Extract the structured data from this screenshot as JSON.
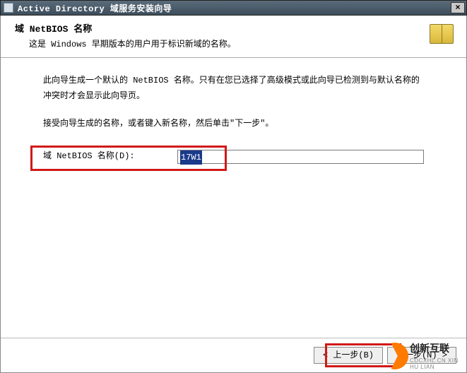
{
  "titlebar": {
    "title": "Active Directory 域服务安装向导",
    "close_label": "×"
  },
  "header": {
    "title": "域 NetBIOS 名称",
    "subtitle": "这是 Windows 早期版本的用户用于标识新域的名称。"
  },
  "content": {
    "para1": "此向导生成一个默认的 NetBIOS 名称。只有在您已选择了高级模式或此向导已检测到与默认名称的冲突时才会显示此向导页。",
    "para2": "接受向导生成的名称，或者键入新名称，然后单击\"下一步\"。"
  },
  "field": {
    "label": "域 NetBIOS 名称(D):",
    "value": "17W1"
  },
  "buttons": {
    "back": "< 上一步(B)",
    "next": "下一步(N) >"
  },
  "watermark": {
    "brand": "创新互联",
    "sub": "CDCXHL.CN XIN HU LIAN"
  }
}
